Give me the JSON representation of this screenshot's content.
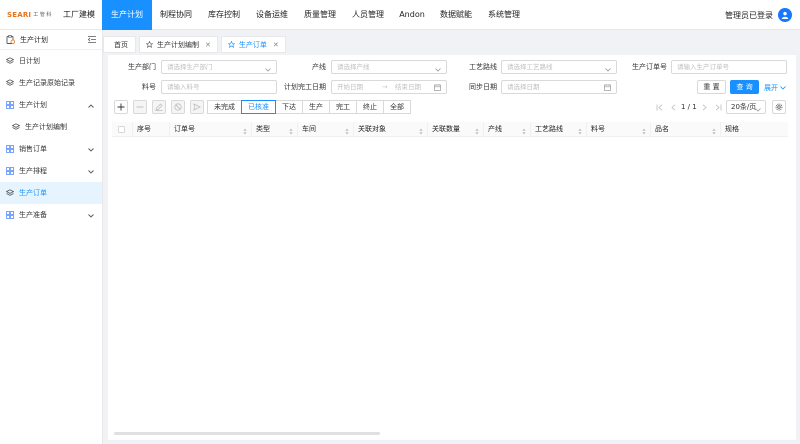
{
  "logo": {
    "main": "SEARI",
    "sub": "工 管 科"
  },
  "nav": [
    "工厂建模",
    "生产计划",
    "制程协同",
    "库存控制",
    "设备运维",
    "质量管理",
    "人员管理",
    "Andon",
    "数据赋能",
    "系统管理"
  ],
  "nav_active": 1,
  "user": {
    "label": "管理员已登录"
  },
  "sidebar": {
    "title": "生产计划",
    "items": [
      {
        "label": "日计划"
      },
      {
        "label": "生产记录原始记录"
      },
      {
        "label": "生产计划"
      },
      {
        "label": "生产计划编制"
      },
      {
        "label": "销售订单"
      },
      {
        "label": "生产排程"
      },
      {
        "label": "生产订单"
      },
      {
        "label": "生产准备"
      }
    ]
  },
  "tabs": [
    {
      "label": "首页"
    },
    {
      "label": "生产计划编制"
    },
    {
      "label": "生产订单"
    }
  ],
  "form": {
    "dept": {
      "label": "生产部门",
      "placeholder": "请选择生产部门"
    },
    "line": {
      "label": "产线",
      "placeholder": "请选择产线"
    },
    "route": {
      "label": "工艺路线",
      "placeholder": "请选择工艺路线"
    },
    "order_no": {
      "label": "生产订单号",
      "placeholder": "请输入生产订单号"
    },
    "material": {
      "label": "料号",
      "placeholder": "请输入料号"
    },
    "plan_date": {
      "label": "计划完工日期",
      "start": "开始日期",
      "end": "结束日期"
    },
    "sync_date": {
      "label": "同步日期",
      "placeholder": "请选择日期"
    },
    "reset": "重 置",
    "query": "查 询",
    "expand": "展开"
  },
  "status_filters": [
    "未完成",
    "已核准",
    "下达",
    "生产",
    "完工",
    "终止",
    "全部"
  ],
  "status_active": 1,
  "pager": {
    "text": "1 / 1",
    "page_size": "20条/页"
  },
  "table": {
    "columns": [
      "序号",
      "订单号",
      "类型",
      "车间",
      "关联对象",
      "关联数量",
      "产线",
      "工艺路线",
      "料号",
      "品名",
      "规格"
    ]
  }
}
